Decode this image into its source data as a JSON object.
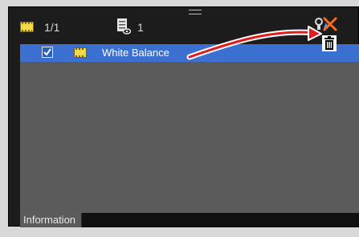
{
  "toolbar": {
    "clip_count": "1/1",
    "layer_count": "1"
  },
  "list": {
    "items": [
      {
        "label": "White Balance",
        "checked": true,
        "selected": true
      }
    ]
  },
  "tabs": [
    {
      "label": "Information"
    }
  ],
  "icons": {
    "clip": "clip-icon",
    "layer": "layer-list-icon",
    "settings": "filter-settings-icon",
    "delete": "delete-x-icon",
    "trash": "trash-icon"
  },
  "colors": {
    "selection": "#3b6fd0",
    "delete": "#ff6a1a",
    "arrow": "#e01c1c"
  }
}
